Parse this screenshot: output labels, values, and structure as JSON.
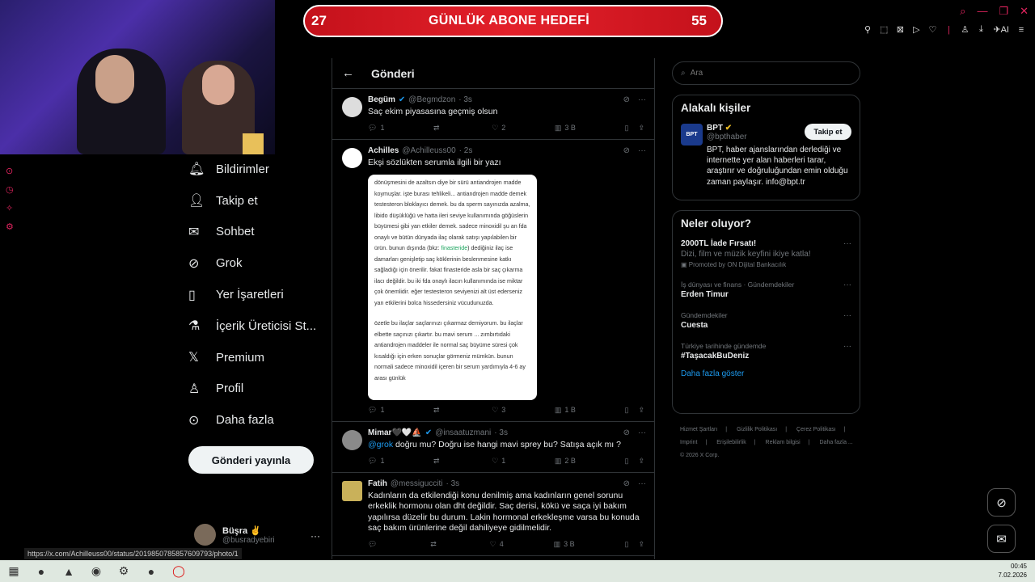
{
  "banner": {
    "left_count": "27",
    "title": "GÜNLÜK ABONE HEDEFİ",
    "right_count": "55"
  },
  "nav": {
    "items": [
      {
        "label": "Bildirimler",
        "icon": "bell-icon"
      },
      {
        "label": "Takip et",
        "icon": "person-add-icon"
      },
      {
        "label": "Sohbet",
        "icon": "mail-icon"
      },
      {
        "label": "Grok",
        "icon": "grok-icon"
      },
      {
        "label": "Yer İşaretleri",
        "icon": "bookmark-icon"
      },
      {
        "label": "İçerik Üreticisi St...",
        "icon": "flask-icon"
      },
      {
        "label": "Premium",
        "icon": "x-logo-icon"
      },
      {
        "label": "Profil",
        "icon": "person-icon"
      },
      {
        "label": "Daha fazla",
        "icon": "more-circle-icon"
      }
    ],
    "post_button": "Gönderi yayınla"
  },
  "user": {
    "name": "Büşra ✌",
    "handle": "@busradyebiri"
  },
  "main": {
    "back": "←",
    "title": "Gönderi",
    "tweets": [
      {
        "name": "Begüm",
        "handle": "@Begmdzon",
        "time": "· 3s",
        "text": "Saç ekim piyasasına geçmiş olsun",
        "replies": "1",
        "retweets": "",
        "likes": "2",
        "views": "3 B"
      },
      {
        "name": "Achilles",
        "handle": "@Achilleuss00",
        "time": "· 2s",
        "text": "Ekşi sözlükten serumla ilgili bir yazı",
        "replies": "1",
        "retweets": "",
        "likes": "3",
        "views": "1 B"
      },
      {
        "name": "Mimar🖤🤍⛵",
        "handle": "@insaatuzmani",
        "time": "· 3s",
        "mention": "@grok",
        "text": " doğru mu? Doğru ise hangi mavi sprey bu? Satışa açık mı ?",
        "replies": "1",
        "retweets": "",
        "likes": "1",
        "views": "2 B"
      },
      {
        "name": "Fatih",
        "handle": "@messigucciti",
        "time": "· 3s",
        "text": "Kadınların da etkilendiği konu denilmiş ama kadınların genel sorunu erkeklik hormonu olan dht değildir. Saç derisi, kökü ve saça iyi bakım yapılırsa düzelir bu durum. Lakin hormonal erkekleşme varsa bu konuda saç bakım ürünlerine değil dahiliyeye gidilmelidir.",
        "replies": "",
        "retweets": "",
        "likes": "4",
        "views": "3 B"
      }
    ],
    "image_text": {
      "p1_a": "dönüşmesini de azaltsın diye bir sürü antiandrojen madde koymuşlar. işte burası tehlikeli... antiandrojen madde demek testesteron bloklayıcı demek. bu da sperm sayınızda azalma, libido düşüklüğü ve hatta ileri seviye kullanımında göğüslerin büyümesi gibi yan etkiler demek. sadece minoxidil şu an fda onaylı ve bütün dünyada ilaç olarak satışı yapılabilen bir ürün. bunun dışında (bkz: ",
      "p1_link": "finasteride",
      "p1_b": ") dediğiniz ilaç ise damarları genişletip saç köklerinin beslenmesine katkı sağladığı için önerilir. fakat finasteride asla bir saç çıkarma ilacı değildir. bu iki fda onaylı ilacın kullanımında ise miktar çok önemlidir. eğer testesteron seviyenizi alt üst ederseniz yan etkilerini bolca hissedersiniz vücudunuzda.",
      "p2": "özetle bu ilaçlar saçlarınızı çıkarmaz demiyorum. bu ilaçlar elbette saçınızı çıkartır. bu mavi serum ... zımbırtıdaki antiandrojen maddeler ile normal saç büyüme süresi çok kısaldığı için erken sonuçlar görmeniz mümkün. bunun normali sadece minoxidil içeren bir serum yardımıyla 4-6 ay arası günlük"
    }
  },
  "search": {
    "placeholder": "Ara"
  },
  "related": {
    "title": "Alakalı kişiler",
    "logo_text": "BPT",
    "name": "BPT",
    "handle": "@bpthaber",
    "follow": "Takip et",
    "bio": "BPT, haber ajanslarından derlediği ve internette yer alan haberleri tarar, araştırır ve doğruluğundan emin olduğu zaman paylaşır. info@bpt.tr"
  },
  "trends": {
    "title": "Neler oluyor?",
    "items": [
      {
        "meta": "",
        "title": "2000TL İade Fırsatı!",
        "sub": "Dizi, film ve müzik keyfini ikiye katla!",
        "promo": "Promoted by ON Dijital Bankacılık"
      },
      {
        "meta": "İş dünyası ve finans · Gündemdekiler",
        "title": "Erden Timur"
      },
      {
        "meta": "Gündemdekiler",
        "title": "Cuesta"
      },
      {
        "meta": "Türkiye tarihinde gündemde",
        "title": "#TaşacakBuDeniz"
      }
    ],
    "show_more": "Daha fazla göster"
  },
  "footer": {
    "links": [
      "Hizmet Şartları",
      "|",
      "Gizlilik Politikası",
      "|",
      "Çerez Politikası",
      "|",
      "Imprint",
      "|",
      "Erişilebilirlik",
      "|",
      "Reklam bilgisi",
      "|",
      "Daha fazla ..."
    ],
    "copyright": "© 2026 X Corp."
  },
  "status_url": "https://x.com/Achilleuss00/status/2019850785857609793/photo/1",
  "clock": {
    "time": "00:45",
    "date": "7.02.2026"
  },
  "colors": {
    "accent": "#1d9bf0",
    "banner": "#e3202a",
    "overlay": "#e0245e"
  }
}
